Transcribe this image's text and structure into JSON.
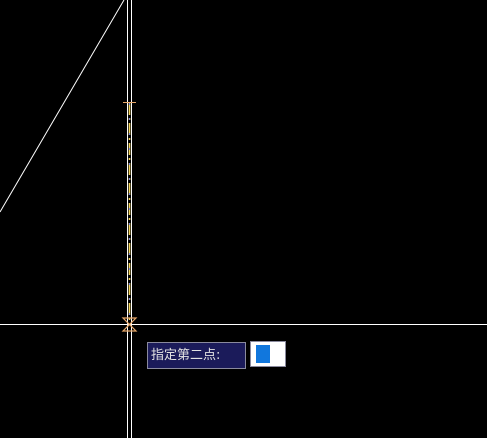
{
  "command_prompt": {
    "label": "指定第二点:",
    "input_value": ""
  },
  "colors": {
    "background": "#000000",
    "drawing_line": "#ffffff",
    "crosshair": "#ffffff",
    "snap_marker": "#e8a86a",
    "prompt_bg": "#1b1b5a",
    "input_cursor": "#1177dd"
  },
  "icons": {
    "snap_marker": "bowtie-endpoint-icon",
    "tick_marker": "tick-mark-icon"
  }
}
